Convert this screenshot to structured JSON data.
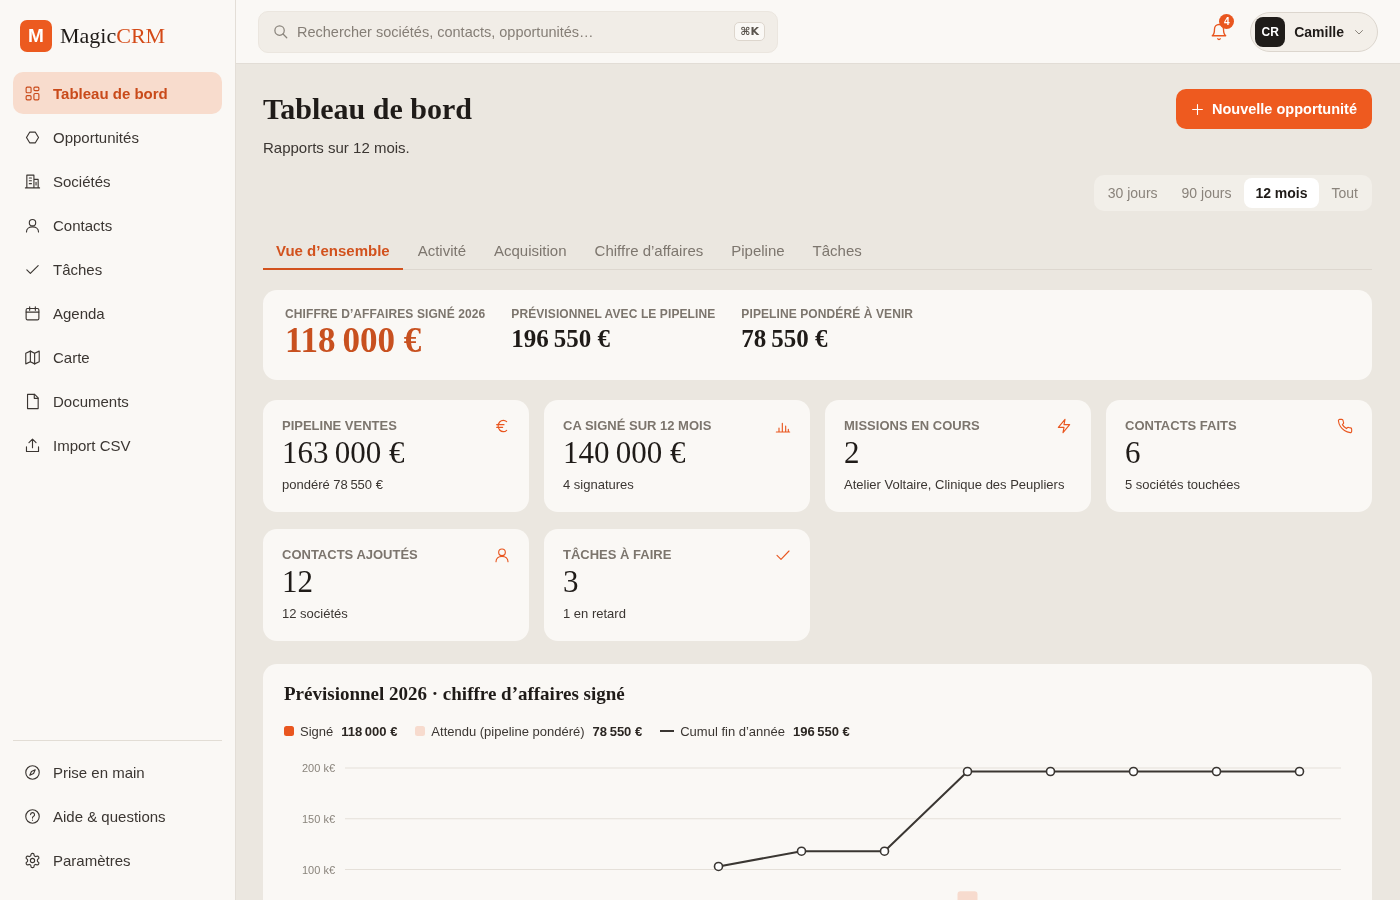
{
  "sidebar": {
    "brand": {
      "mark": "M",
      "name": "Magic",
      "accent": "CRM"
    },
    "nav": [
      {
        "label": "Tableau de bord",
        "selected": true
      },
      {
        "label": "Opportunités",
        "selected": false
      },
      {
        "label": "Sociétés",
        "selected": false
      },
      {
        "label": "Contacts",
        "selected": false
      },
      {
        "label": "Tâches",
        "selected": false
      },
      {
        "label": "Agenda",
        "selected": false
      },
      {
        "label": "Carte",
        "selected": false
      },
      {
        "label": "Documents",
        "selected": false
      },
      {
        "label": "Import CSV",
        "selected": false
      }
    ],
    "footer_nav": [
      {
        "label": "Prise en main",
        "selected": false
      },
      {
        "label": "Aide & questions",
        "selected": false
      },
      {
        "label": "Paramètres",
        "selected": false
      }
    ]
  },
  "topbar": {
    "search": {
      "placeholder": "Rechercher sociétés, contacts, opportunités…",
      "shortcut": "⌘K"
    },
    "notifications": {
      "count": "4"
    },
    "user": {
      "initials": "CR",
      "name": "Camille"
    }
  },
  "header": {
    "title": "Tableau de bord",
    "subtitle": "Rapports sur 12 mois.",
    "action": "Nouvelle opportunité"
  },
  "periods": [
    {
      "label": "30 jours",
      "selected": false
    },
    {
      "label": "90 jours",
      "selected": false
    },
    {
      "label": "12 mois",
      "selected": true
    },
    {
      "label": "Tout",
      "selected": false
    }
  ],
  "tabs": [
    {
      "label": "Vue d’ensemble",
      "selected": true
    },
    {
      "label": "Activité",
      "selected": false
    },
    {
      "label": "Acquisition",
      "selected": false
    },
    {
      "label": "Chiffre d’affaires",
      "selected": false
    },
    {
      "label": "Pipeline",
      "selected": false
    },
    {
      "label": "Tâches",
      "selected": false
    }
  ],
  "summary": [
    {
      "label": "CHIFFRE D’AFFAIRES SIGNÉ 2026",
      "value": "118 000 €",
      "highlight": true
    },
    {
      "label": "PRÉVISIONNEL AVEC LE PIPELINE",
      "value": "196 550 €",
      "highlight": false
    },
    {
      "label": "PIPELINE PONDÉRÉ À VENIR",
      "value": "78 550 €",
      "highlight": false
    }
  ],
  "kpis": [
    {
      "label": "PIPELINE VENTES",
      "value": "163 000 €",
      "note": "pondéré 78 550 €"
    },
    {
      "label": "CA SIGNÉ SUR 12 MOIS",
      "value": "140 000 €",
      "note": "4 signatures"
    },
    {
      "label": "MISSIONS EN COURS",
      "value": "2",
      "note": "Atelier Voltaire, Clinique des Peupliers"
    },
    {
      "label": "CONTACTS FAITS",
      "value": "6",
      "note": "5 sociétés touchées"
    },
    {
      "label": "CONTACTS AJOUTÉS",
      "value": "12",
      "note": "12 sociétés"
    },
    {
      "label": "TÂCHES À FAIRE",
      "value": "3",
      "note": "1 en retard"
    }
  ],
  "chart": {
    "title": "Prévisionnel 2026 · chiffre d’affaires signé",
    "totals": [
      "118 000 €",
      "78 550 €",
      "196 550 €"
    ],
    "chart_data": {
      "type": "line",
      "stacked": true,
      "grid": true,
      "ylim": [
        0,
        200000
      ],
      "yticks": [
        {
          "value": 100000,
          "label": "100 k€"
        },
        {
          "value": 150000,
          "label": "150 k€"
        },
        {
          "value": 200000,
          "label": "200 k€"
        }
      ],
      "series": [
        {
          "name": "Signé",
          "type": "bar",
          "color": "#e9561f",
          "values": [
            null,
            null,
            null,
            null,
            null,
            null,
            null,
            null,
            null,
            null,
            null,
            null
          ]
        },
        {
          "name": "Attendu (pipeline pondéré)",
          "type": "bar",
          "color": "#f7dbce",
          "values": [
            null,
            null,
            null,
            null,
            null,
            null,
            null,
            78550,
            null,
            null,
            null,
            null
          ]
        },
        {
          "name": "Cumul fin d’année",
          "type": "line",
          "marker": true,
          "color": "#3a3632",
          "values": [
            null,
            null,
            null,
            null,
            103000,
            118000,
            118000,
            196550,
            196550,
            196550,
            196550,
            196550
          ]
        }
      ]
    }
  }
}
